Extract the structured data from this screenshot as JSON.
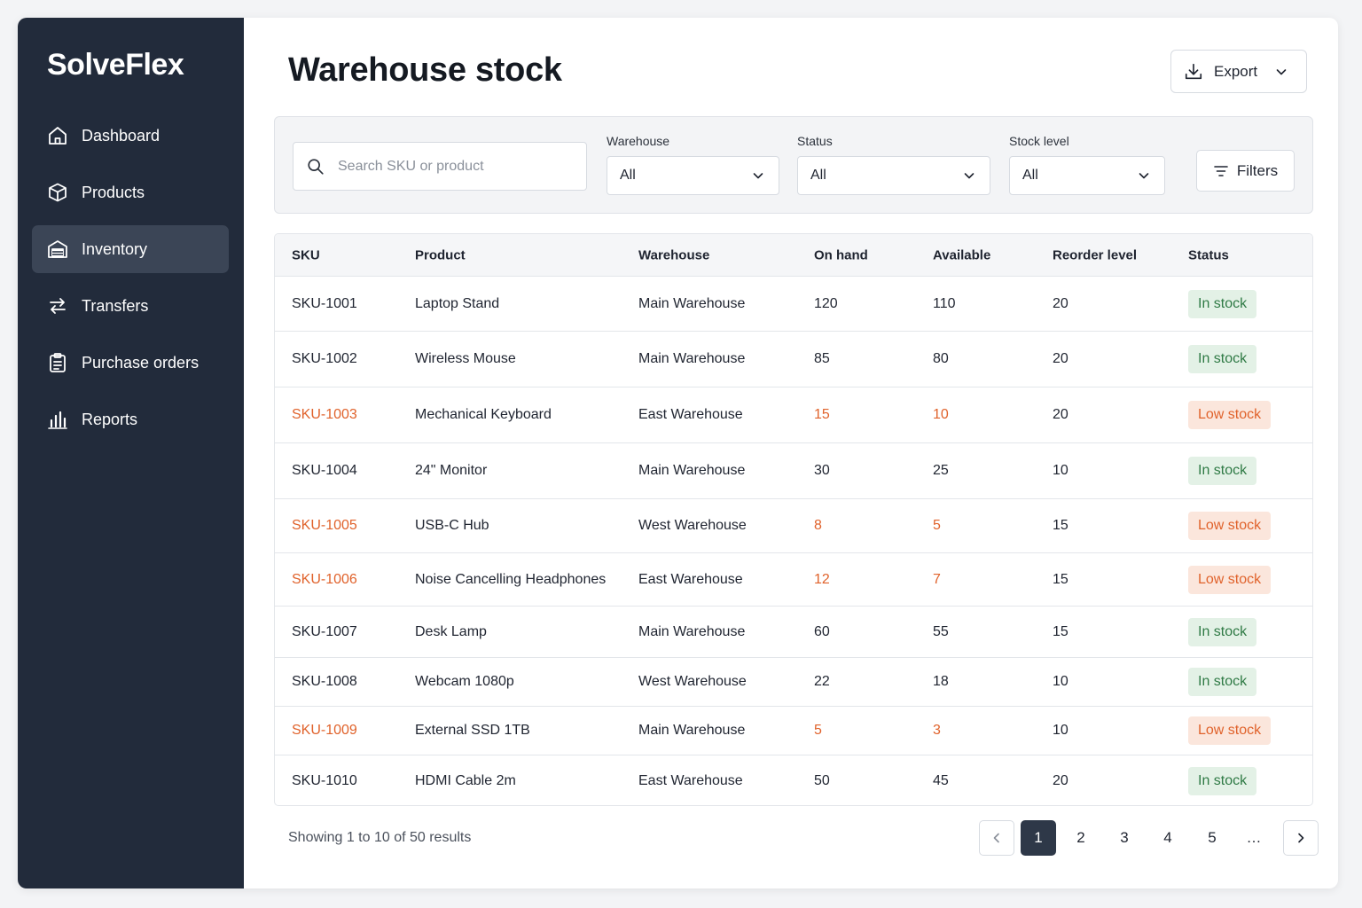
{
  "app": {
    "name": "SolveFlex"
  },
  "sidebar": {
    "items": [
      {
        "label": "Dashboard",
        "icon": "home-icon",
        "active": false
      },
      {
        "label": "Products",
        "icon": "box-icon",
        "active": false
      },
      {
        "label": "Inventory",
        "icon": "warehouse-icon",
        "active": true
      },
      {
        "label": "Transfers",
        "icon": "transfer-arrows-icon",
        "active": false
      },
      {
        "label": "Purchase orders",
        "icon": "clipboard-icon",
        "active": false
      },
      {
        "label": "Reports",
        "icon": "bar-chart-icon",
        "active": false
      }
    ]
  },
  "header": {
    "title": "Warehouse stock",
    "export_label": "Export"
  },
  "filters": {
    "search_placeholder": "Search SKU or product",
    "warehouse": {
      "label": "Warehouse",
      "value": "All"
    },
    "status": {
      "label": "Status",
      "value": "All"
    },
    "stock_level": {
      "label": "Stock level",
      "value": "All"
    },
    "filters_button": "Filters"
  },
  "table": {
    "columns": [
      "SKU",
      "Product",
      "Warehouse",
      "On hand",
      "Available",
      "Reorder level",
      "Status"
    ],
    "rows": [
      {
        "sku": "SKU-1001",
        "product": "Laptop Stand",
        "warehouse": "Main Warehouse",
        "on_hand": "120",
        "available": "110",
        "reorder": "20",
        "status": "In stock",
        "low": false
      },
      {
        "sku": "SKU-1002",
        "product": "Wireless Mouse",
        "warehouse": "Main Warehouse",
        "on_hand": "85",
        "available": "80",
        "reorder": "20",
        "status": "In stock",
        "low": false
      },
      {
        "sku": "SKU-1003",
        "product": "Mechanical Keyboard",
        "warehouse": "East Warehouse",
        "on_hand": "15",
        "available": "10",
        "reorder": "20",
        "status": "Low stock",
        "low": true
      },
      {
        "sku": "SKU-1004",
        "product": "24\" Monitor",
        "warehouse": "Main Warehouse",
        "on_hand": "30",
        "available": "25",
        "reorder": "10",
        "status": "In stock",
        "low": false
      },
      {
        "sku": "SKU-1005",
        "product": "USB-C Hub",
        "warehouse": "West Warehouse",
        "on_hand": "8",
        "available": "5",
        "reorder": "15",
        "status": "Low stock",
        "low": true
      },
      {
        "sku": "SKU-1006",
        "product": "Noise Cancelling Headphones",
        "warehouse": "East Warehouse",
        "on_hand": "12",
        "available": "7",
        "reorder": "15",
        "status": "Low stock",
        "low": true
      },
      {
        "sku": "SKU-1007",
        "product": "Desk Lamp",
        "warehouse": "Main Warehouse",
        "on_hand": "60",
        "available": "55",
        "reorder": "15",
        "status": "In stock",
        "low": false
      },
      {
        "sku": "SKU-1008",
        "product": "Webcam 1080p",
        "warehouse": "West Warehouse",
        "on_hand": "22",
        "available": "18",
        "reorder": "10",
        "status": "In stock",
        "low": false
      },
      {
        "sku": "SKU-1009",
        "product": "External SSD 1TB",
        "warehouse": "Main Warehouse",
        "on_hand": "5",
        "available": "3",
        "reorder": "10",
        "status": "Low stock",
        "low": true
      },
      {
        "sku": "SKU-1010",
        "product": "HDMI Cable 2m",
        "warehouse": "East Warehouse",
        "on_hand": "50",
        "available": "45",
        "reorder": "20",
        "status": "In stock",
        "low": false
      }
    ]
  },
  "footer": {
    "results_text": "Showing 1 to 10 of 50 results",
    "pages": [
      "1",
      "2",
      "3",
      "4",
      "5",
      "…"
    ],
    "current_page": "1"
  },
  "colors": {
    "sidebar_bg": "#222b3b",
    "active_item_bg": "#3b4556",
    "warning": "#e0622b",
    "success_text": "#2f7a45",
    "success_bg": "#e3f1e6",
    "warning_bg": "#fbe6dc"
  }
}
